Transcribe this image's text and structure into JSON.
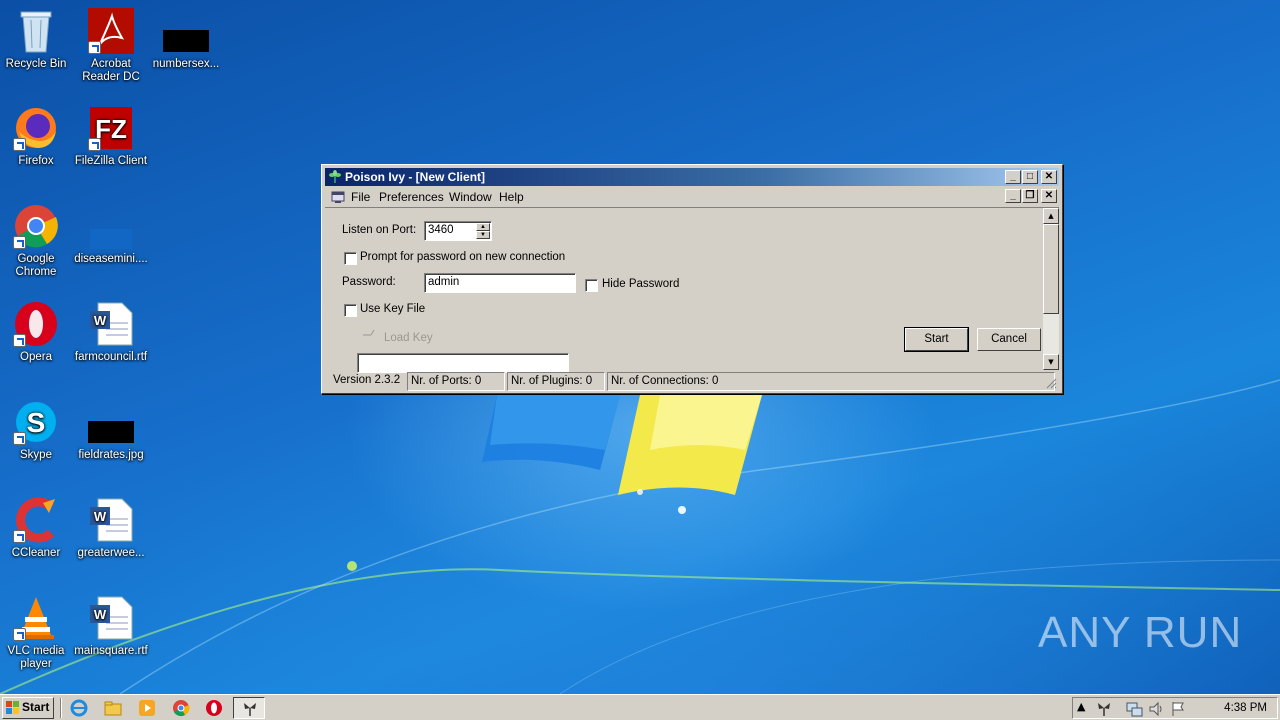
{
  "desktop": {
    "icons": [
      {
        "label": "Recycle Bin",
        "icon": "recycle-bin-icon"
      },
      {
        "label": "Acrobat Reader DC",
        "icon": "acrobat-icon"
      },
      {
        "label": "numbersex...",
        "icon": "redacted-file-icon"
      },
      {
        "label": "Firefox",
        "icon": "firefox-icon"
      },
      {
        "label": "FileZilla Client",
        "icon": "filezilla-icon"
      },
      {
        "label": "Google Chrome",
        "icon": "chrome-icon"
      },
      {
        "label": "diseasemini....",
        "icon": "redacted-file-icon"
      },
      {
        "label": "Opera",
        "icon": "opera-icon"
      },
      {
        "label": "farmcouncil.rtf",
        "icon": "word-document-icon"
      },
      {
        "label": "Skype",
        "icon": "skype-icon"
      },
      {
        "label": "fieldrates.jpg",
        "icon": "image-file-icon"
      },
      {
        "label": "CCleaner",
        "icon": "ccleaner-icon"
      },
      {
        "label": "greaterwee...",
        "icon": "word-document-icon"
      },
      {
        "label": "VLC media player",
        "icon": "vlc-icon"
      },
      {
        "label": "mainsquare.rtf",
        "icon": "word-document-icon"
      }
    ]
  },
  "window": {
    "title": "Poison Ivy - [New Client]",
    "menu": [
      "File",
      "Preferences",
      "Window",
      "Help"
    ],
    "caption_buttons": {
      "minimize": "_",
      "maximize": "□",
      "close": "✕",
      "restore": "❐"
    },
    "form": {
      "listen_port_label": "Listen on Port:",
      "listen_port_value": "3460",
      "prompt_label": "Prompt for password on new connection",
      "password_label": "Password:",
      "password_value": "admin",
      "hide_password_label": "Hide Password",
      "use_key_file_label": "Use Key File",
      "load_key_label": "Load Key",
      "key_path_value": "",
      "start_label": "Start",
      "cancel_label": "Cancel"
    },
    "status": {
      "version": "Version 2.3.2",
      "ports": "Nr. of Ports: 0",
      "plugins": "Nr. of Plugins: 0",
      "connections": "Nr. of Connections: 0"
    }
  },
  "taskbar": {
    "start_label": "Start",
    "quick_launch": [
      "ie-icon",
      "explorer-icon",
      "media-player-icon",
      "chrome-icon",
      "opera-icon"
    ],
    "active_task": "poison-ivy-icon",
    "tray_icons": [
      "show-hidden-icon",
      "poison-ivy-tray-icon",
      "network-icon",
      "volume-icon",
      "flag-icon"
    ],
    "clock": "4:38 PM"
  },
  "watermark": "ANY RUN",
  "colors": {
    "titlebar_start": "#0a246a",
    "titlebar_end": "#a6caf0",
    "window_face": "#d4d0c8",
    "desktop": "#1770cc"
  }
}
